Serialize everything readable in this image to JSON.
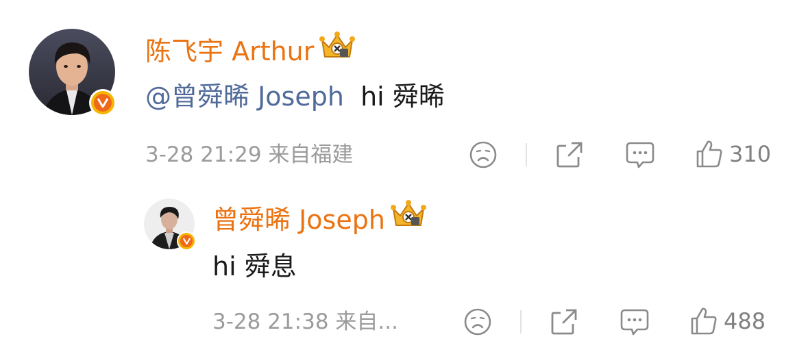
{
  "comment": {
    "author": "陈飞宇 Arthur",
    "mention": "@曾舜晞 Joseph",
    "text": "hi 舜晞",
    "meta": "3-28 21:29 来自福建",
    "likes": "310"
  },
  "reply": {
    "author": "曾舜晞 Joseph",
    "text": "hi 舜息",
    "meta": "3-28 21:38 来自...",
    "likes": "488"
  },
  "icons": {
    "verified": "verified-v-badge-icon",
    "crown": "vip-crown-icon",
    "dislike": "sad-face-icon",
    "share": "share-icon",
    "comment": "comment-bubble-icon",
    "like": "thumbs-up-icon"
  },
  "colors": {
    "name_orange": "#eb7311",
    "mention_blue": "#506a9a",
    "text_black": "#1a1a1a",
    "meta_gray": "#9b9b9b",
    "icon_gray": "#8a8a8a",
    "badge_yellow": "#f7b500"
  }
}
